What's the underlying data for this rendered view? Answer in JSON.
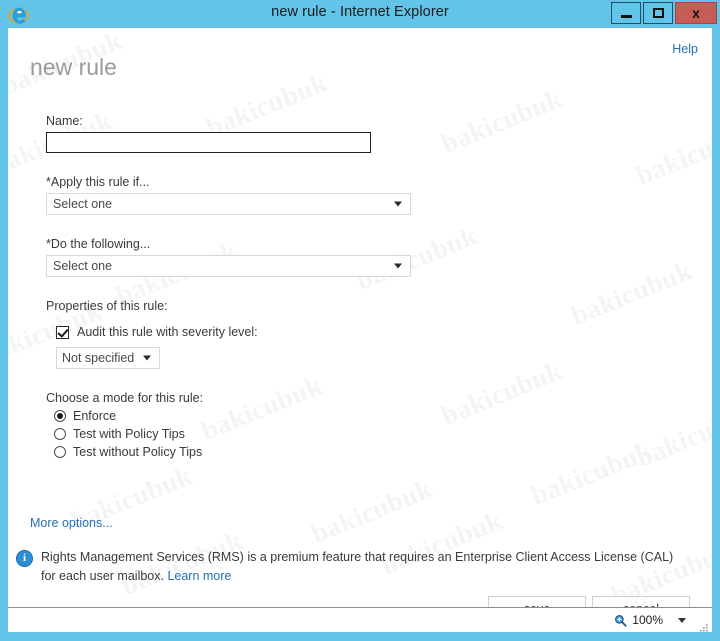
{
  "window": {
    "title": "new rule - Internet Explorer",
    "app_icon": "internet-explorer-icon",
    "controls": {
      "minimize": "minimize-icon",
      "maximize": "maximize-icon",
      "close": "x"
    }
  },
  "page": {
    "help_label": "Help",
    "title": "new rule"
  },
  "form": {
    "name_label": "Name:",
    "name_value": "",
    "name_placeholder": "",
    "apply_label": "*Apply this rule if...",
    "apply_value": "Select one",
    "do_label": "*Do the following...",
    "do_value": "Select one",
    "properties_label": "Properties of this rule:",
    "audit_checkbox_label": "Audit this rule with severity level:",
    "audit_checked": true,
    "severity_value": "Not specified",
    "mode_label": "Choose a mode for this rule:",
    "modes": [
      {
        "label": "Enforce",
        "selected": true
      },
      {
        "label": "Test with Policy Tips",
        "selected": false
      },
      {
        "label": "Test without Policy Tips",
        "selected": false
      }
    ],
    "more_options_label": "More options..."
  },
  "notice": {
    "icon": "info-icon",
    "text": "Rights Management Services (RMS) is a premium feature that requires an Enterprise Client Access License (CAL) for each user mailbox. ",
    "link_label": "Learn more"
  },
  "actions": {
    "save_label": "save",
    "cancel_label": "cancel"
  },
  "statusbar": {
    "zoom_icon": "zoom-magnifier-icon",
    "zoom_level": "100%"
  },
  "watermark": {
    "text": "bakicubuk"
  }
}
